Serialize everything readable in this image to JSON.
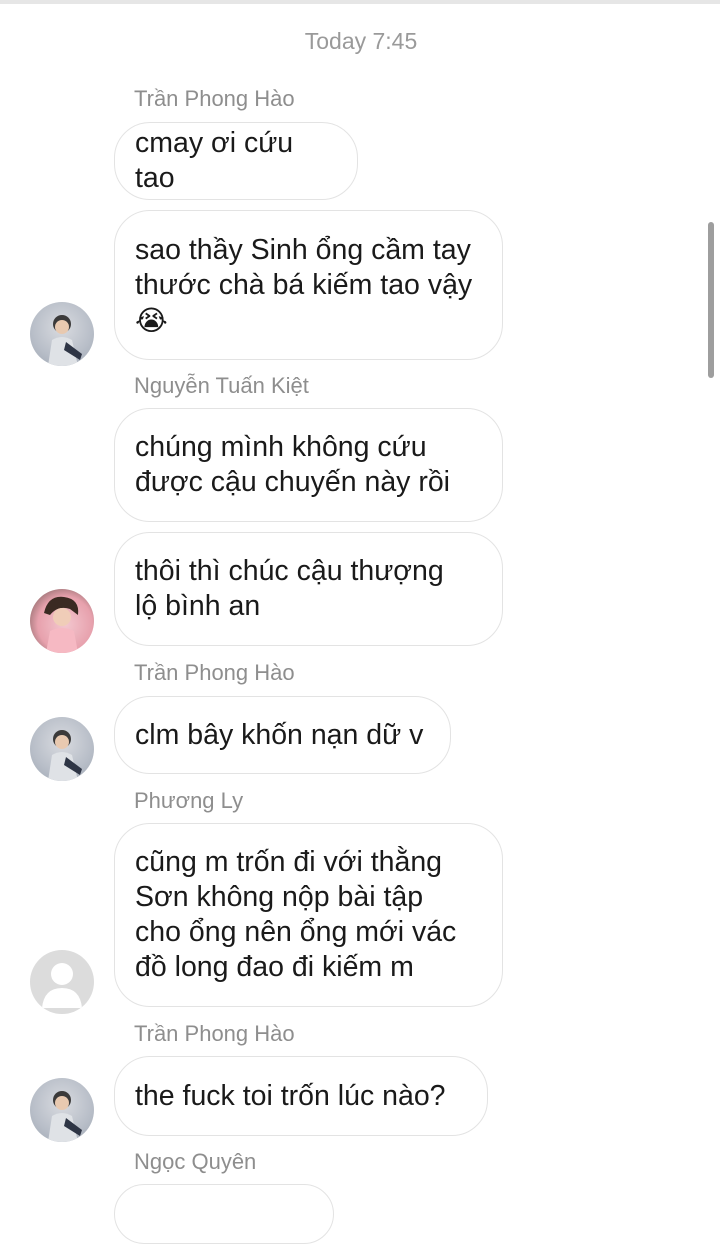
{
  "chat": {
    "timestamp": "Today 7:45",
    "messages": [
      {
        "sender": "Trần Phong Hào",
        "text": "cmay ơi cứu tao"
      },
      {
        "text_line1": "sao thầy Sinh ổng cầm tay",
        "text_line2": "thước chà bá kiếm tao vậy",
        "emoji": "😭",
        "emoji_name": "loudly-crying-face-icon"
      },
      {
        "sender": "Nguyễn Tuấn Kiệt",
        "text_line1": "chúng mình không cứu",
        "text_line2": "được cậu chuyến này rồi"
      },
      {
        "text_line1": "thôi thì chúc cậu thượng",
        "text_line2": "lộ bình an"
      },
      {
        "sender": "Trần Phong Hào",
        "text": "clm bây khốn nạn dữ v"
      },
      {
        "sender": "Phương Ly",
        "text_line1": "cũng m trốn đi với thằng",
        "text_line2": "Sơn không nộp bài tập",
        "text_line3": "cho ổng nên ổng mới vác",
        "text_line4": "đồ long đao đi kiếm m"
      },
      {
        "sender": "Trần Phong Hào",
        "text": "the fuck toi trốn lúc nào?"
      },
      {
        "sender": "Ngọc Quyên"
      }
    ]
  },
  "colors": {
    "bubble_border": "#e3e3e3",
    "sender_text": "#8e8e8e",
    "timestamp_text": "#9a9a9a",
    "message_text": "#1a1a1a"
  }
}
